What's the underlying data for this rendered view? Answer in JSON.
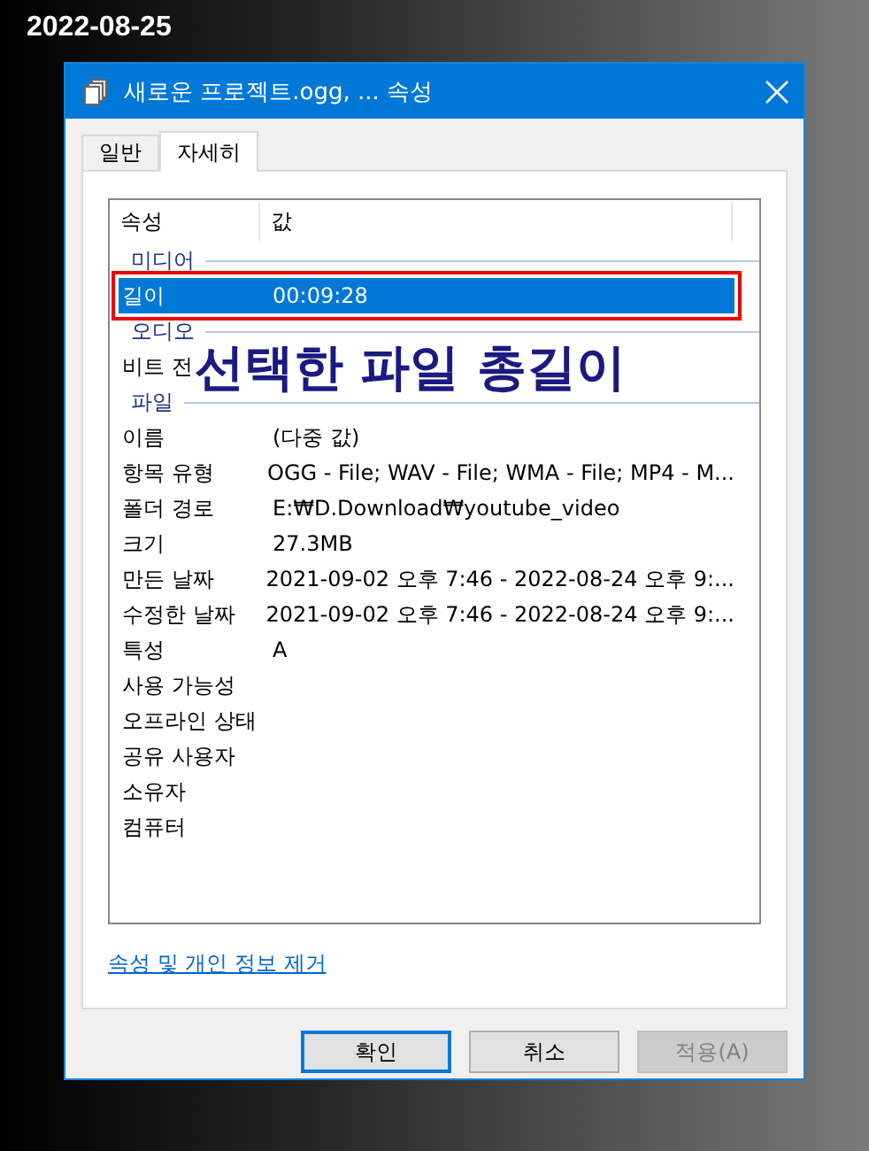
{
  "date": "2022-08-25",
  "window": {
    "title": "새로운 프로젝트.ogg, ... 속성"
  },
  "tabs": [
    {
      "label": "일반",
      "selected": false
    },
    {
      "label": "자세히",
      "selected": true
    }
  ],
  "table": {
    "columns": [
      "속성",
      "값"
    ],
    "rows": [
      {
        "kind": "group",
        "label": "미디어"
      },
      {
        "kind": "property",
        "label": "길이",
        "value": "00:09:28",
        "selected": true,
        "annotated": true
      },
      {
        "kind": "group",
        "label": "오디오"
      },
      {
        "kind": "property",
        "label": "비트 전",
        "selected": false,
        "annotated": false
      },
      {
        "kind": "group",
        "label": "파일"
      },
      {
        "kind": "property",
        "label": "이름",
        "value": "(다중 값)",
        "selected": false,
        "annotated": false
      },
      {
        "kind": "property",
        "label": "항목 유형",
        "value": "OGG - File; WAV - File; WMA - File; MP4 - M...",
        "selected": false,
        "annotated": false
      },
      {
        "kind": "property",
        "label": "폴더 경로",
        "value": "E:₩D.Download₩youtube_video",
        "selected": false,
        "annotated": false
      },
      {
        "kind": "property",
        "label": "크기",
        "value": "27.3MB",
        "selected": false,
        "annotated": false
      },
      {
        "kind": "property",
        "label": "만든 날짜",
        "value": "2021-09-02 오후 7:46 - 2022-08-24 오후 9:...",
        "selected": false,
        "annotated": false
      },
      {
        "kind": "property",
        "label": "수정한 날짜",
        "value": "2021-09-02 오후 7:46 - 2022-08-24 오후 9:...",
        "selected": false,
        "annotated": false
      },
      {
        "kind": "property",
        "label": "특성",
        "value": "A",
        "selected": false,
        "annotated": false
      },
      {
        "kind": "property",
        "label": "사용 가능성",
        "selected": false,
        "annotated": false
      },
      {
        "kind": "property",
        "label": "오프라인 상태",
        "selected": false,
        "annotated": false
      },
      {
        "kind": "property",
        "label": "공유 사용자",
        "selected": false,
        "annotated": false
      },
      {
        "kind": "property",
        "label": "소유자",
        "selected": false,
        "annotated": false
      },
      {
        "kind": "property",
        "label": "컴퓨터",
        "selected": false,
        "annotated": false
      }
    ]
  },
  "annotation": "선택한 파일 총길이",
  "link": "속성 및 개인 정보 제거",
  "buttons": [
    {
      "label": "확인",
      "disabled": false,
      "selected": true
    },
    {
      "label": "취소",
      "disabled": false,
      "selected": false
    },
    {
      "label": "적용(A)",
      "disabled": true,
      "selected": false
    }
  ]
}
